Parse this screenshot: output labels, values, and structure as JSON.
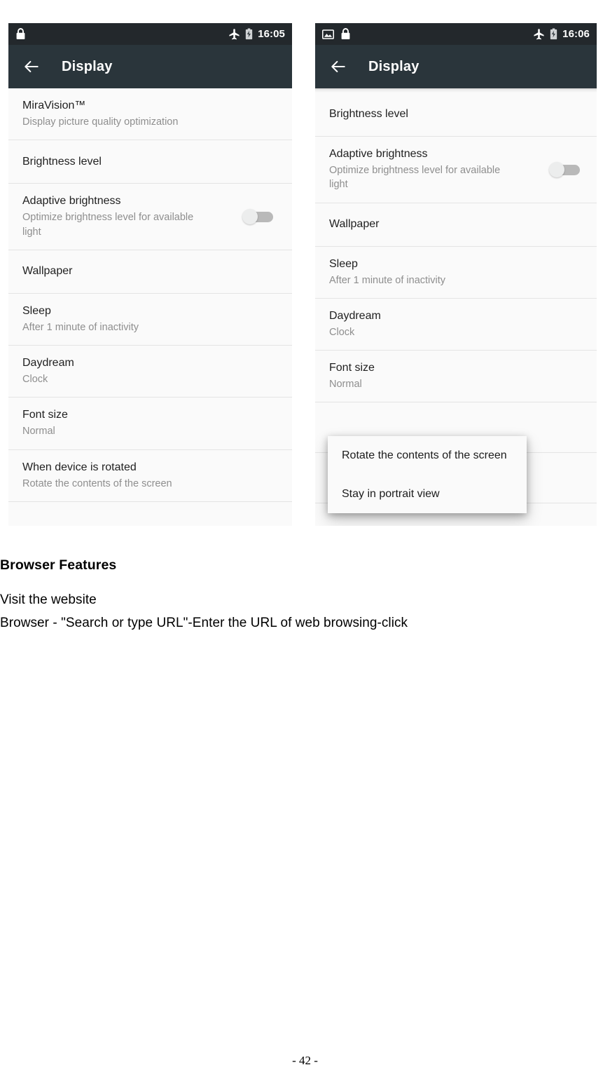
{
  "phones": [
    {
      "id": "left",
      "status_bar": {
        "icons_left": [
          "lock-icon"
        ],
        "icons_right": [
          "airplane-mode-icon",
          "battery-icon"
        ],
        "time": "16:05"
      },
      "app_bar": {
        "back_icon": "back-arrow-icon",
        "title": "Display"
      },
      "scrolled": false,
      "items": [
        {
          "title": "MiraVision™",
          "summary": "Display picture quality optimization",
          "control": "none"
        },
        {
          "title": "Brightness level",
          "summary": "",
          "control": "none"
        },
        {
          "title": "Adaptive brightness",
          "summary": "Optimize brightness level for available light",
          "control": "switch",
          "switch_state": "off"
        },
        {
          "title": "Wallpaper",
          "summary": "",
          "control": "none"
        },
        {
          "title": "Sleep",
          "summary": "After 1 minute of inactivity",
          "control": "none"
        },
        {
          "title": "Daydream",
          "summary": "Clock",
          "control": "none"
        },
        {
          "title": "Font size",
          "summary": "Normal",
          "control": "none"
        },
        {
          "title": "When device is rotated",
          "summary": "Rotate the contents of the screen",
          "control": "none"
        }
      ],
      "popup": null
    },
    {
      "id": "right",
      "status_bar": {
        "icons_left": [
          "screenshot-image-icon",
          "lock-icon"
        ],
        "icons_right": [
          "airplane-mode-icon",
          "battery-icon"
        ],
        "time": "16:06"
      },
      "app_bar": {
        "back_icon": "back-arrow-icon",
        "title": "Display"
      },
      "scrolled": true,
      "items": [
        {
          "title": "Brightness level",
          "summary": "",
          "control": "none"
        },
        {
          "title": "Adaptive brightness",
          "summary": "Optimize brightness level for available light",
          "control": "switch",
          "switch_state": "off"
        },
        {
          "title": "Wallpaper",
          "summary": "",
          "control": "none"
        },
        {
          "title": "Sleep",
          "summary": "After 1 minute of inactivity",
          "control": "none"
        },
        {
          "title": "Daydream",
          "summary": "Clock",
          "control": "none"
        },
        {
          "title": "Font size",
          "summary": "Normal",
          "control": "none"
        },
        {
          "title": "",
          "summary": "",
          "control": "none"
        },
        {
          "title": "",
          "summary": "",
          "control": "none"
        }
      ],
      "popup": {
        "options": [
          "Rotate the contents of the screen",
          "Stay in portrait view"
        ]
      }
    }
  ],
  "document": {
    "heading": "Browser Features",
    "lines": [
      "Visit the website",
      "Browser - \"Search or type URL\"-Enter the URL of web browsing-click"
    ],
    "page_number": "- 42 -"
  },
  "colors": {
    "status_bar": "#23282c",
    "app_bar": "#2a353b",
    "list_background": "#fafafa",
    "divider": "#e4e4e4",
    "title_text": "#1f1f1f",
    "summary_text": "#8e8e8e",
    "switch_track_off": "#b9b9b9",
    "switch_knob_off": "#eceded"
  }
}
